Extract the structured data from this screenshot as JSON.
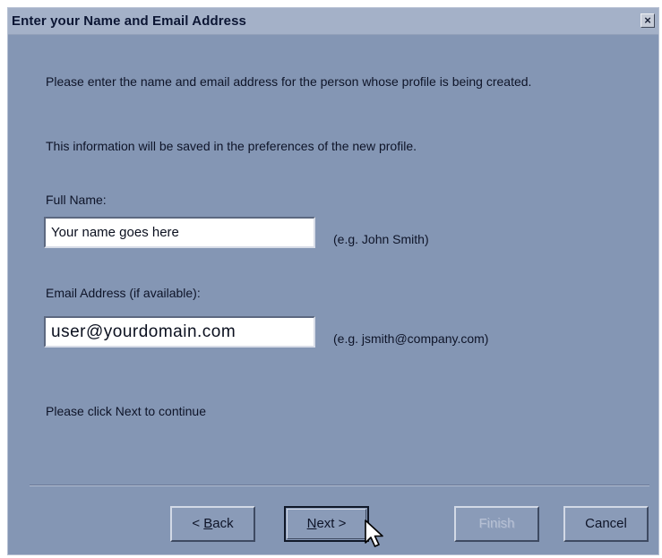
{
  "window": {
    "title": "Enter your Name and Email Address",
    "close_glyph": "×"
  },
  "content": {
    "intro": "Please enter the name and email address for the person whose profile is being created.",
    "info": "This information will be saved in the preferences of the new profile.",
    "full_name_label": "Full Name:",
    "full_name_value": "Your name goes here",
    "full_name_hint": "(e.g. John Smith)",
    "email_label": "Email Address (if available):",
    "email_value": "user@yourdomain.com",
    "email_hint": "(e.g. jsmith@company.com)",
    "continue_text": "Please click Next to continue"
  },
  "buttons": {
    "back_prefix": "< ",
    "back_accel": "B",
    "back_rest": "ack",
    "next_accel": "N",
    "next_rest": "ext >",
    "finish": "Finish",
    "cancel": "Cancel"
  },
  "icons": {
    "close": "close-icon",
    "cursor": "pointer-cursor-icon"
  },
  "colors": {
    "dialog_bg": "#8496b4",
    "titlebar_bg": "#a4b1c8",
    "text": "#0e1428"
  }
}
